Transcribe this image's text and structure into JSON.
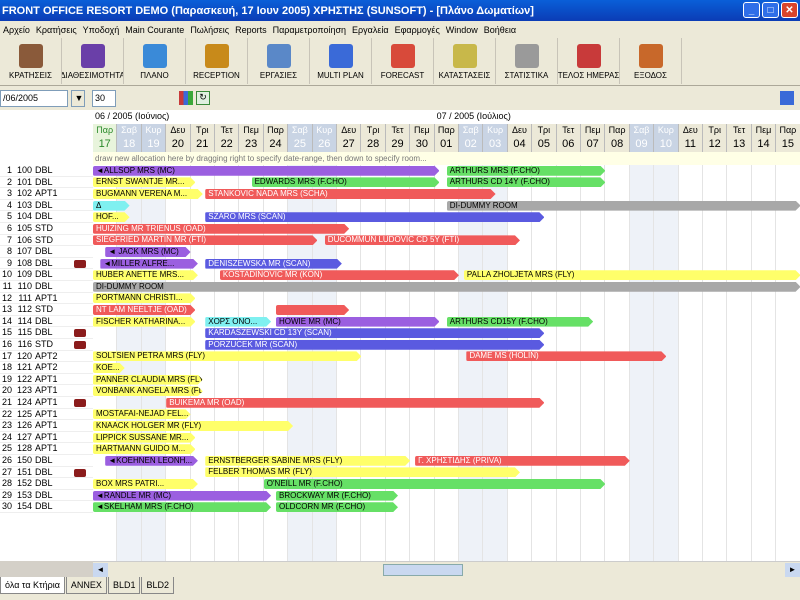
{
  "window": {
    "title": "FRONT OFFICE      RESORT DEMO (Παρασκευή, 17 Ιουν 2005)      ΧΡΗΣΤΗΣ (SUNSOFT) - [Πλάνο Δωματίων]",
    "btn_min": "_",
    "btn_max": "□",
    "btn_close": "✕"
  },
  "menu": [
    "Αρχείο",
    "Κρατήσεις",
    "Υποδοχή",
    "Main Courante",
    "Πωλήσεις",
    "Reports",
    "Παραμετροποίηση",
    "Εργαλεία",
    "Εφαρμογές",
    "Window",
    "Βοήθεια"
  ],
  "toolbar": [
    {
      "label": "ΚΡΑΤΗΣΕΙΣ",
      "icon": "reservations-icon",
      "color": "#8a5a3a"
    },
    {
      "label": "ΔΙΑΘΕΣΙΜΟΤΗΤΑ",
      "icon": "availability-icon",
      "color": "#6a3fa8"
    },
    {
      "label": "ΠΛΑΝΟ",
      "icon": "plan-icon",
      "color": "#3a8ad8"
    },
    {
      "label": "RECEPTION",
      "icon": "bell-icon",
      "color": "#c88a1a"
    },
    {
      "label": "ΕΡΓΑΣΙΕΣ",
      "icon": "keys-icon",
      "color": "#5a88c8"
    },
    {
      "label": "MULTI PLAN",
      "icon": "multiplan-icon",
      "color": "#3a6ad8"
    },
    {
      "label": "FORECAST",
      "icon": "forecast-icon",
      "color": "#d84a3a"
    },
    {
      "label": "ΚΑΤΑΣΤΑΣΕΙΣ",
      "icon": "status-icon",
      "color": "#c8b84a"
    },
    {
      "label": "ΣΤΑΤΙΣΤΙΚΑ",
      "icon": "statistics-icon",
      "color": "#9a9a9a"
    },
    {
      "label": "ΤΕΛΟΣ ΗΜΕΡΑΣ",
      "icon": "calendar-icon",
      "color": "#c83a3a"
    },
    {
      "label": "ΕΞΟΔΟΣ",
      "icon": "exit-icon",
      "color": "#c8682a"
    }
  ],
  "filter": {
    "date": "/06/2005",
    "days": "30"
  },
  "months": [
    {
      "label": "06 / 2005  (Ιούνιος)"
    },
    {
      "label": "07 / 2005  (Ιούλιος)"
    }
  ],
  "days": [
    {
      "dw": "Παρ",
      "dn": "17",
      "type": "today"
    },
    {
      "dw": "Σαβ",
      "dn": "18",
      "type": "we"
    },
    {
      "dw": "Κυρ",
      "dn": "19",
      "type": "we"
    },
    {
      "dw": "Δευ",
      "dn": "20"
    },
    {
      "dw": "Τρι",
      "dn": "21"
    },
    {
      "dw": "Τετ",
      "dn": "22"
    },
    {
      "dw": "Πεμ",
      "dn": "23"
    },
    {
      "dw": "Παρ",
      "dn": "24"
    },
    {
      "dw": "Σαβ",
      "dn": "25",
      "type": "we"
    },
    {
      "dw": "Κυρ",
      "dn": "26",
      "type": "we"
    },
    {
      "dw": "Δευ",
      "dn": "27"
    },
    {
      "dw": "Τρι",
      "dn": "28"
    },
    {
      "dw": "Τετ",
      "dn": "29"
    },
    {
      "dw": "Πεμ",
      "dn": "30"
    },
    {
      "dw": "Παρ",
      "dn": "01"
    },
    {
      "dw": "Σαβ",
      "dn": "02",
      "type": "we"
    },
    {
      "dw": "Κυρ",
      "dn": "03",
      "type": "we"
    },
    {
      "dw": "Δευ",
      "dn": "04"
    },
    {
      "dw": "Τρι",
      "dn": "05"
    },
    {
      "dw": "Τετ",
      "dn": "06"
    },
    {
      "dw": "Πεμ",
      "dn": "07"
    },
    {
      "dw": "Παρ",
      "dn": "08"
    },
    {
      "dw": "Σαβ",
      "dn": "09",
      "type": "we"
    },
    {
      "dw": "Κυρ",
      "dn": "10",
      "type": "we"
    },
    {
      "dw": "Δευ",
      "dn": "11"
    },
    {
      "dw": "Τρι",
      "dn": "12"
    },
    {
      "dw": "Τετ",
      "dn": "13"
    },
    {
      "dw": "Πεμ",
      "dn": "14"
    },
    {
      "dw": "Παρ",
      "dn": "15"
    }
  ],
  "hint": "draw new allocation here by dragging right to specify date-range, then down to specify room...",
  "rooms": [
    {
      "n": "1",
      "no": "100",
      "t": "DBL"
    },
    {
      "n": "2",
      "no": "101",
      "t": "DBL"
    },
    {
      "n": "3",
      "no": "102",
      "t": "APT1"
    },
    {
      "n": "4",
      "no": "103",
      "t": "DBL"
    },
    {
      "n": "5",
      "no": "104",
      "t": "DBL"
    },
    {
      "n": "6",
      "no": "105",
      "t": "STD"
    },
    {
      "n": "7",
      "no": "106",
      "t": "STD"
    },
    {
      "n": "8",
      "no": "107",
      "t": "DBL"
    },
    {
      "n": "9",
      "no": "108",
      "t": "DBL",
      "lock": true
    },
    {
      "n": "10",
      "no": "109",
      "t": "DBL"
    },
    {
      "n": "11",
      "no": "110",
      "t": "DBL"
    },
    {
      "n": "12",
      "no": "111",
      "t": "APT1"
    },
    {
      "n": "13",
      "no": "112",
      "t": "STD"
    },
    {
      "n": "14",
      "no": "114",
      "t": "DBL"
    },
    {
      "n": "15",
      "no": "115",
      "t": "DBL",
      "lock": true
    },
    {
      "n": "16",
      "no": "116",
      "t": "STD",
      "lock": true
    },
    {
      "n": "17",
      "no": "120",
      "t": "APT2"
    },
    {
      "n": "18",
      "no": "121",
      "t": "APT2"
    },
    {
      "n": "19",
      "no": "122",
      "t": "APT1"
    },
    {
      "n": "20",
      "no": "123",
      "t": "APT1"
    },
    {
      "n": "21",
      "no": "124",
      "t": "APT1",
      "lock": true
    },
    {
      "n": "22",
      "no": "125",
      "t": "APT1"
    },
    {
      "n": "23",
      "no": "126",
      "t": "APT1"
    },
    {
      "n": "24",
      "no": "127",
      "t": "APT1"
    },
    {
      "n": "25",
      "no": "128",
      "t": "APT1"
    },
    {
      "n": "26",
      "no": "150",
      "t": "DBL"
    },
    {
      "n": "27",
      "no": "151",
      "t": "DBL",
      "lock": true
    },
    {
      "n": "28",
      "no": "152",
      "t": "DBL"
    },
    {
      "n": "29",
      "no": "153",
      "t": "DBL"
    },
    {
      "n": "30",
      "no": "154",
      "t": "DBL"
    }
  ],
  "bookings": [
    {
      "r": 0,
      "s": 0,
      "e": 14.2,
      "c": "purple",
      "l": "◄ALLSOP MRS (MC)"
    },
    {
      "r": 0,
      "s": 14.5,
      "e": 21.0,
      "c": "green",
      "l": "ARTHURS MRS (F.CHO)"
    },
    {
      "r": 1,
      "s": 0,
      "e": 4.2,
      "c": "yellow",
      "l": "ERNST SWANTJE MR..."
    },
    {
      "r": 1,
      "s": 6.5,
      "e": 14.2,
      "c": "green",
      "l": "EDWARDS MRS (F.CHO)"
    },
    {
      "r": 1,
      "s": 14.5,
      "e": 21.0,
      "c": "green",
      "l": "ARTHURS CD 14Y (F.CHO)"
    },
    {
      "r": 2,
      "s": 0,
      "e": 4.5,
      "c": "yellow",
      "l": "BUGMANN VERENA M..."
    },
    {
      "r": 2,
      "s": 4.6,
      "e": 16.5,
      "c": "red",
      "l": "STANKOVIC NADA MRS (SCHA)"
    },
    {
      "r": 3,
      "s": 0,
      "e": 1.5,
      "c": "cyan",
      "l": "Δ"
    },
    {
      "r": 3,
      "s": 14.5,
      "e": 29.0,
      "c": "gray",
      "l": "DI-DUMMY ROOM"
    },
    {
      "r": 4,
      "s": 0,
      "e": 1.5,
      "c": "yellow",
      "l": "HOF..."
    },
    {
      "r": 4,
      "s": 4.6,
      "e": 18.5,
      "c": "blue",
      "l": "SZARO MRS (SCAN)"
    },
    {
      "r": 5,
      "s": 0,
      "e": 10.5,
      "c": "red",
      "l": "HUIZING MR TRIENUS (OAD)"
    },
    {
      "r": 6,
      "s": 0,
      "e": 9.2,
      "c": "red",
      "l": "SIEGFRIED MARTIN MR (FTI)"
    },
    {
      "r": 6,
      "s": 9.5,
      "e": 17.5,
      "c": "red",
      "l": "DUCOMMUN LUDOVIC CD 5Y (FTI)"
    },
    {
      "r": 7,
      "s": 0.5,
      "e": 4.0,
      "c": "purple",
      "l": "◄ JACK MRS (MC)"
    },
    {
      "r": 8,
      "s": 0.3,
      "e": 4.3,
      "c": "purple",
      "l": "◄MILLER ALFRE..."
    },
    {
      "r": 8,
      "s": 4.6,
      "e": 10.2,
      "c": "blue",
      "l": "DENISZEWSKA MR (SCAN)"
    },
    {
      "r": 9,
      "s": 0,
      "e": 4.3,
      "c": "yellow",
      "l": "HUBER ANETTE MRS..."
    },
    {
      "r": 9,
      "s": 5.2,
      "e": 15.0,
      "c": "red",
      "l": "KOSTADINOVIC MR (KON)"
    },
    {
      "r": 9,
      "s": 15.2,
      "e": 29.0,
      "c": "yellow",
      "l": "PALLA ZHOLJETA MRS (FLY)"
    },
    {
      "r": 10,
      "s": 0,
      "e": 29.0,
      "c": "gray",
      "l": "DI-DUMMY ROOM"
    },
    {
      "r": 11,
      "s": 0,
      "e": 4.2,
      "c": "yellow",
      "l": "PORTMANN CHRISTI..."
    },
    {
      "r": 12,
      "s": 0,
      "e": 4.2,
      "c": "red",
      "l": "NT LAM NEELTJE (OAD)"
    },
    {
      "r": 12,
      "s": 7.5,
      "e": 10.5,
      "c": "red",
      "l": ""
    },
    {
      "r": 13,
      "s": 0,
      "e": 4.2,
      "c": "yellow",
      "l": "FISCHER KATHARINA..."
    },
    {
      "r": 13,
      "s": 4.6,
      "e": 7.3,
      "c": "cyan",
      "l": "ΧΟΡΣ ΟΝΟ..."
    },
    {
      "r": 13,
      "s": 7.5,
      "e": 14.2,
      "c": "purple",
      "l": "HOWIE MR (MC)"
    },
    {
      "r": 13,
      "s": 14.5,
      "e": 20.5,
      "c": "green",
      "l": "ARTHURS CD15Y (F.CHO)"
    },
    {
      "r": 14,
      "s": 4.6,
      "e": 18.5,
      "c": "blue",
      "l": "KARDASZEWSKI CD 13Y (SCAN)"
    },
    {
      "r": 15,
      "s": 4.6,
      "e": 18.5,
      "c": "blue",
      "l": "PORZUCEK MR (SCAN)"
    },
    {
      "r": 16,
      "s": 0,
      "e": 11.0,
      "c": "yellow",
      "l": "SOLTSIEN PETRA MRS (FLY)"
    },
    {
      "r": 16,
      "s": 15.3,
      "e": 23.5,
      "c": "red",
      "l": "DAME MS (HOLIN)"
    },
    {
      "r": 17,
      "s": 0,
      "e": 1.3,
      "c": "yellow",
      "l": "KOE..."
    },
    {
      "r": 18,
      "s": 0,
      "e": 4.5,
      "c": "yellow",
      "l": "PANNER CLAUDIA MRS (FLY)"
    },
    {
      "r": 19,
      "s": 0,
      "e": 4.5,
      "c": "yellow",
      "l": "VONBANK ANGELA MRS (FLY)"
    },
    {
      "r": 20,
      "s": 3.0,
      "e": 18.5,
      "c": "red",
      "l": "BUIKEMA MR (OAD)"
    },
    {
      "r": 21,
      "s": 0,
      "e": 4.0,
      "c": "yellow",
      "l": "MOSTAFAI-NEJAD FEL..."
    },
    {
      "r": 22,
      "s": 0,
      "e": 8.2,
      "c": "yellow",
      "l": "KNAACK HOLGER MR (FLY)"
    },
    {
      "r": 23,
      "s": 0,
      "e": 4.2,
      "c": "yellow",
      "l": "LIPPICK SUSSANE MR..."
    },
    {
      "r": 24,
      "s": 0,
      "e": 4.2,
      "c": "yellow",
      "l": "HARTMANN GUIDO M..."
    },
    {
      "r": 25,
      "s": 0.5,
      "e": 4.3,
      "c": "purple",
      "l": "◄KOEHNEN LEONH..."
    },
    {
      "r": 25,
      "s": 4.6,
      "e": 13.0,
      "c": "yellow",
      "l": "ERNSTBERGER SABINE MRS (FLY)"
    },
    {
      "r": 25,
      "s": 13.2,
      "e": 22.0,
      "c": "red",
      "l": "Γ. ΧΡΗΣΤΙΔΗΣ (PRIVA)"
    },
    {
      "r": 26,
      "s": 4.6,
      "e": 17.5,
      "c": "yellow",
      "l": "FELBER THOMAS MR (FLY)"
    },
    {
      "r": 27,
      "s": 0,
      "e": 4.3,
      "c": "yellow",
      "l": "BOX MRS PATRI..."
    },
    {
      "r": 27,
      "s": 7.0,
      "e": 21.0,
      "c": "green",
      "l": "O'NEILL MR (F.CHO)"
    },
    {
      "r": 28,
      "s": 0,
      "e": 7.3,
      "c": "purple",
      "l": "◄RANDLE MR (MC)"
    },
    {
      "r": 28,
      "s": 7.5,
      "e": 12.5,
      "c": "green",
      "l": "BROCKWAY MR (F.CHO)"
    },
    {
      "r": 29,
      "s": 0,
      "e": 7.3,
      "c": "green",
      "l": "◄SKELHAM MRS (F.CHO)"
    },
    {
      "r": 29,
      "s": 7.5,
      "e": 12.5,
      "c": "green",
      "l": "OLDCORN MR (F.CHO)"
    }
  ],
  "bottom_tabs": [
    "όλα τα Κτήρια",
    "ANNEX",
    "BLD1",
    "BLD2"
  ]
}
